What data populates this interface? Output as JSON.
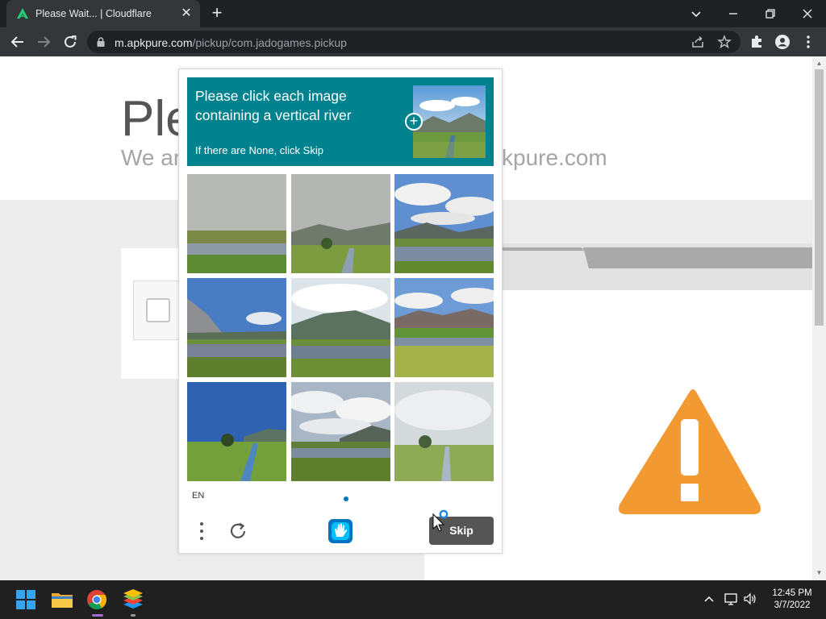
{
  "browser": {
    "tab_title": "Please Wait... | Cloudflare",
    "tab_close": "✕",
    "new_tab": "+",
    "url_domain": "m.apkpure.com",
    "url_path": "/pickup/com.jadogames.pickup"
  },
  "page": {
    "title_partial": "Ple",
    "subtitle_left_partial": "We ar",
    "subtitle_right_partial": "kpure.com"
  },
  "captcha": {
    "prompt": "Please click each image containing a vertical river",
    "hint": "If there are None, click Skip",
    "language": "EN",
    "skip_label": "Skip",
    "plus": "+",
    "accent_color": "#00838f"
  },
  "taskbar": {
    "time": "12:45 PM",
    "date": "3/7/2022"
  }
}
